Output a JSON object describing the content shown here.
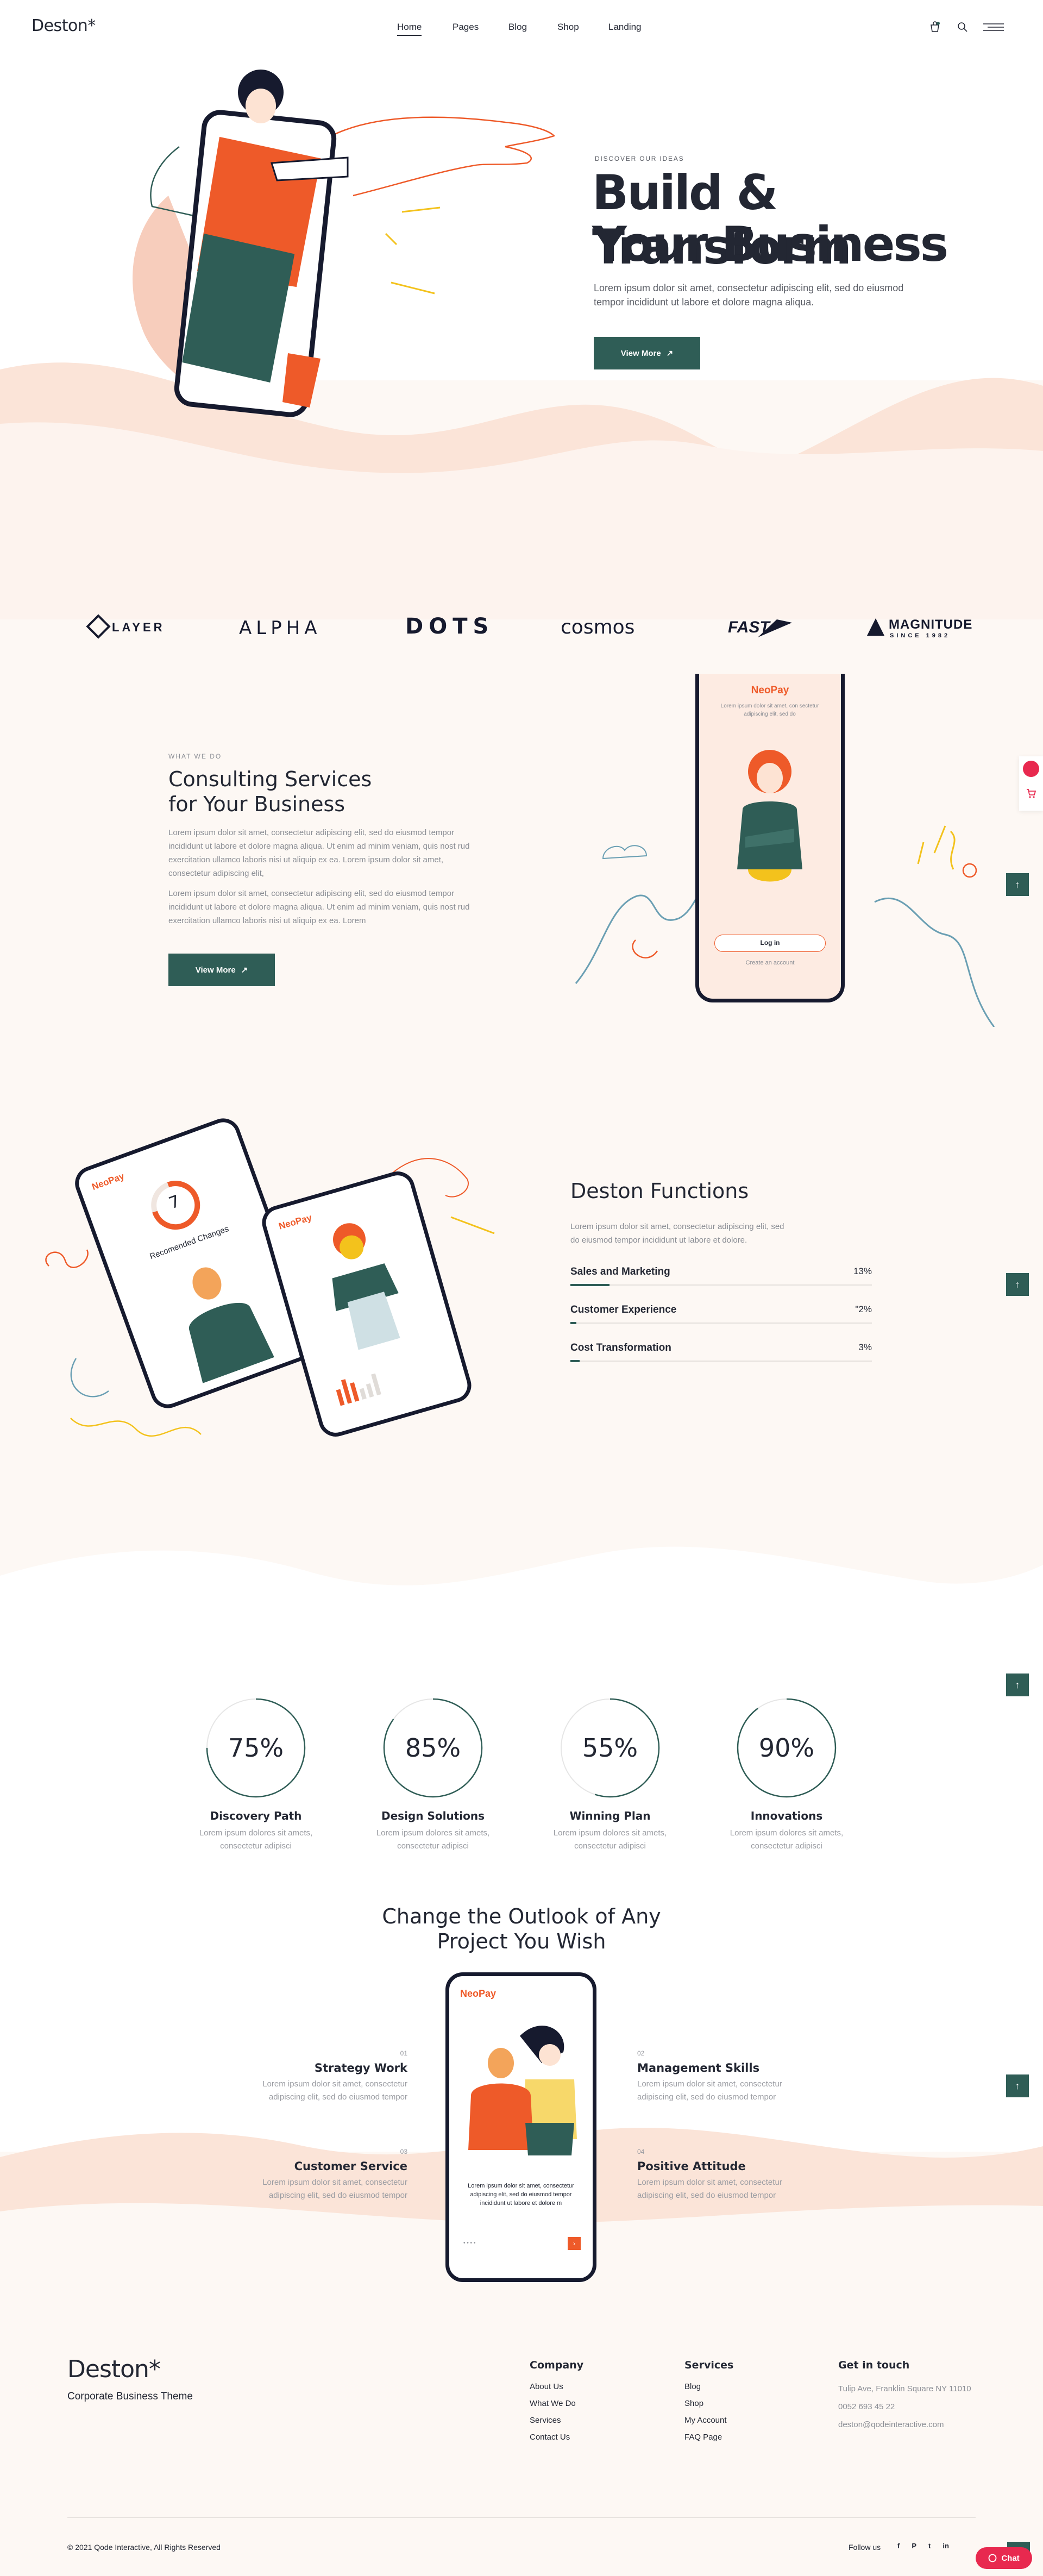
{
  "header": {
    "logo": "Deston*",
    "nav": [
      {
        "label": "Home"
      },
      {
        "label": "Pages"
      },
      {
        "label": "Blog"
      },
      {
        "label": "Shop"
      },
      {
        "label": "Landing"
      }
    ]
  },
  "hero": {
    "eyebrow": "DISCOVER OUR IDEAS",
    "title_line1": "Build & Transform",
    "title_line2": "Your Business",
    "text_line1": "Lorem ipsum dolor sit amet, consectetur adipiscing elit, sed do eiusmod",
    "text_line2": "tempor incididunt ut labore et dolore magna aliqua.",
    "button": "View More",
    "arrow": "↗"
  },
  "logos": [
    "LAYER",
    "ALPHA",
    "DOTS",
    "cosmos",
    "FAST",
    "MAGNITUDE",
    "SINCE 1982"
  ],
  "consulting": {
    "eyebrow": "WHAT WE DO",
    "title_line1": "Consulting Services",
    "title_line2": "for Your Business",
    "para1": "Lorem ipsum dolor sit amet, consectetur adipiscing elit, sed do eiusmod tempor incididunt ut labore et dolore magna aliqua. Ut enim ad minim veniam, quis nost rud exercitation ullamco laboris nisi ut aliquip ex ea. Lorem ipsum dolor sit amet, consectetur adipiscing elit,",
    "para2": "Lorem ipsum dolor sit amet, consectetur adipiscing elit, sed do eiusmod tempor incididunt ut labore et dolore magna aliqua. Ut enim ad minim veniam, quis nost rud exercitation ullamco laboris nisi ut aliquip ex ea. Lorem",
    "button": "View More",
    "phone": {
      "brand": "NeoPay",
      "text": "Lorem ipsum dolor sit amet, con sectetur adipiscing elit, sed do",
      "login": "Log in",
      "create": "Create an account"
    }
  },
  "functions": {
    "title": "Deston Functions",
    "text": "Lorem ipsum dolor sit amet, consectetur adipiscing elit, sed do eiusmod tempor incididunt ut labore et dolore.",
    "skills": [
      {
        "label": "Sales and Marketing",
        "percent_text": "13%",
        "value": 0.13
      },
      {
        "label": "Customer Experience",
        "percent_text": "\"2%",
        "value": 0.02
      },
      {
        "label": "Cost Transformation",
        "percent_text": "3%",
        "value": 0.03
      }
    ],
    "phone_left": {
      "brand": "NeoPay",
      "number": "7",
      "caption": "Recomended Changes"
    },
    "phone_right": {
      "brand": "NeoPay"
    }
  },
  "circles": [
    {
      "value_text": "75%",
      "value": 0.75,
      "title": "Discovery Path",
      "desc1": "Lorem ipsum dolores sit amets,",
      "desc2": "consectetur adipisci"
    },
    {
      "value_text": "85%",
      "value": 0.85,
      "title": "Design Solutions",
      "desc1": "Lorem ipsum dolores sit amets,",
      "desc2": "consectetur adipisci"
    },
    {
      "value_text": "55%",
      "value": 0.55,
      "title": "Winning Plan",
      "desc1": "Lorem ipsum dolores sit amets,",
      "desc2": "consectetur adipisci"
    },
    {
      "value_text": "90%",
      "value": 0.9,
      "title": "Innovations",
      "desc1": "Lorem ipsum dolores sit amets,",
      "desc2": "consectetur adipisci"
    }
  ],
  "outlook": {
    "title_line1": "Change the Outlook of Any",
    "title_line2": "Project You Wish",
    "features": [
      {
        "num": "01",
        "title": "Strategy Work",
        "desc": "Lorem ipsum dolor sit amet, consectetur adipiscing elit, sed do eiusmod tempor"
      },
      {
        "num": "02",
        "title": "Management Skills",
        "desc": "Lorem ipsum dolor sit amet, consectetur adipiscing elit, sed do eiusmod tempor"
      },
      {
        "num": "03",
        "title": "Customer Service",
        "desc": "Lorem ipsum dolor sit amet, consectetur adipiscing elit, sed do eiusmod tempor"
      },
      {
        "num": "04",
        "title": "Positive Attitude",
        "desc": "Lorem ipsum dolor sit amet, consectetur adipiscing elit, sed do eiusmod tempor"
      }
    ],
    "phone": {
      "brand": "NeoPay",
      "text": "Lorem ipsum dolor sit amet, consectetur adipiscing elit, sed do eiusmod tempor incididunt ut labore et dolore m"
    }
  },
  "footer": {
    "logo": "Deston*",
    "tagline": "Corporate Business Theme",
    "company": {
      "title": "Company",
      "links": [
        "About Us",
        "What We Do",
        "Services",
        "Contact Us"
      ]
    },
    "services": {
      "title": "Services",
      "links": [
        "Blog",
        "Shop",
        "My Account",
        "FAQ Page"
      ]
    },
    "contact": {
      "title": "Get in touch",
      "address": "Tulip Ave, Franklin Square NY 11010",
      "phone": "0052 693 45 22",
      "email": "deston@qodeinteractive.com"
    },
    "copyright": "© 2021 Qode Interactive, All Rights Reserved",
    "follow": "Follow us",
    "social": [
      "f",
      "P",
      "t",
      "in"
    ],
    "chat": "Chat"
  },
  "colors": {
    "accent": "#2f5d56",
    "orange": "#ee5a29",
    "navy": "#161a2e",
    "pink": "#e8294f"
  }
}
